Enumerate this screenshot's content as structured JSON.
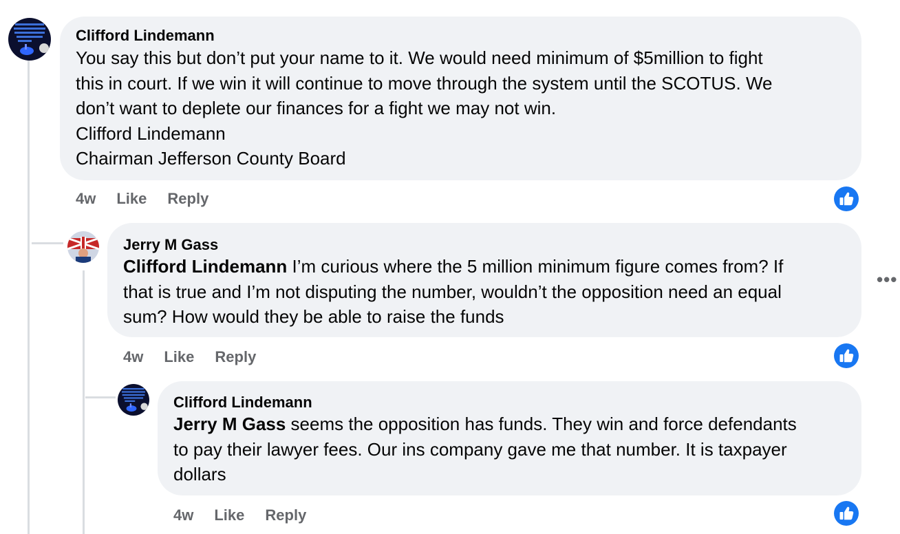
{
  "comments": [
    {
      "author": "Clifford Lindemann",
      "lines": [
        "You say this but don’t put your name to it. We would need minimum of $5million to fight",
        "this in court. If we win it will continue to move through the system until the SCOTUS. We",
        "don’t want to deplete our finances for a fight we may not win.",
        "Clifford Lindemann",
        "Chairman Jefferson County Board"
      ],
      "time": "4w",
      "like_label": "Like",
      "reply_label": "Reply",
      "avatar_icon": "candle-avatar-icon"
    },
    {
      "author": "Jerry M Gass",
      "mention": "Clifford Lindemann",
      "lines": [
        " I’m curious where the 5 million minimum figure comes from? If",
        "that is true and I’m not disputing the number, wouldn’t the opposition need an equal",
        "sum? How would they be able to raise the funds"
      ],
      "time": "4w",
      "like_label": "Like",
      "reply_label": "Reply",
      "avatar_icon": "flag-avatar-icon"
    },
    {
      "author": "Clifford Lindemann",
      "mention": "Jerry M Gass",
      "lines": [
        " seems the opposition has funds. They win and force defendants",
        "to pay their lawyer fees. Our ins company gave me that number. It is taxpayer",
        "dollars"
      ],
      "time": "4w",
      "like_label": "Like",
      "reply_label": "Reply",
      "avatar_icon": "candle-avatar-icon"
    }
  ],
  "more_icon": "more-options-icon",
  "colors": {
    "bubble": "#f0f2f5",
    "secondary_text": "#65676b",
    "like_blue": "#1877f2",
    "thread_line": "#dadde1"
  }
}
